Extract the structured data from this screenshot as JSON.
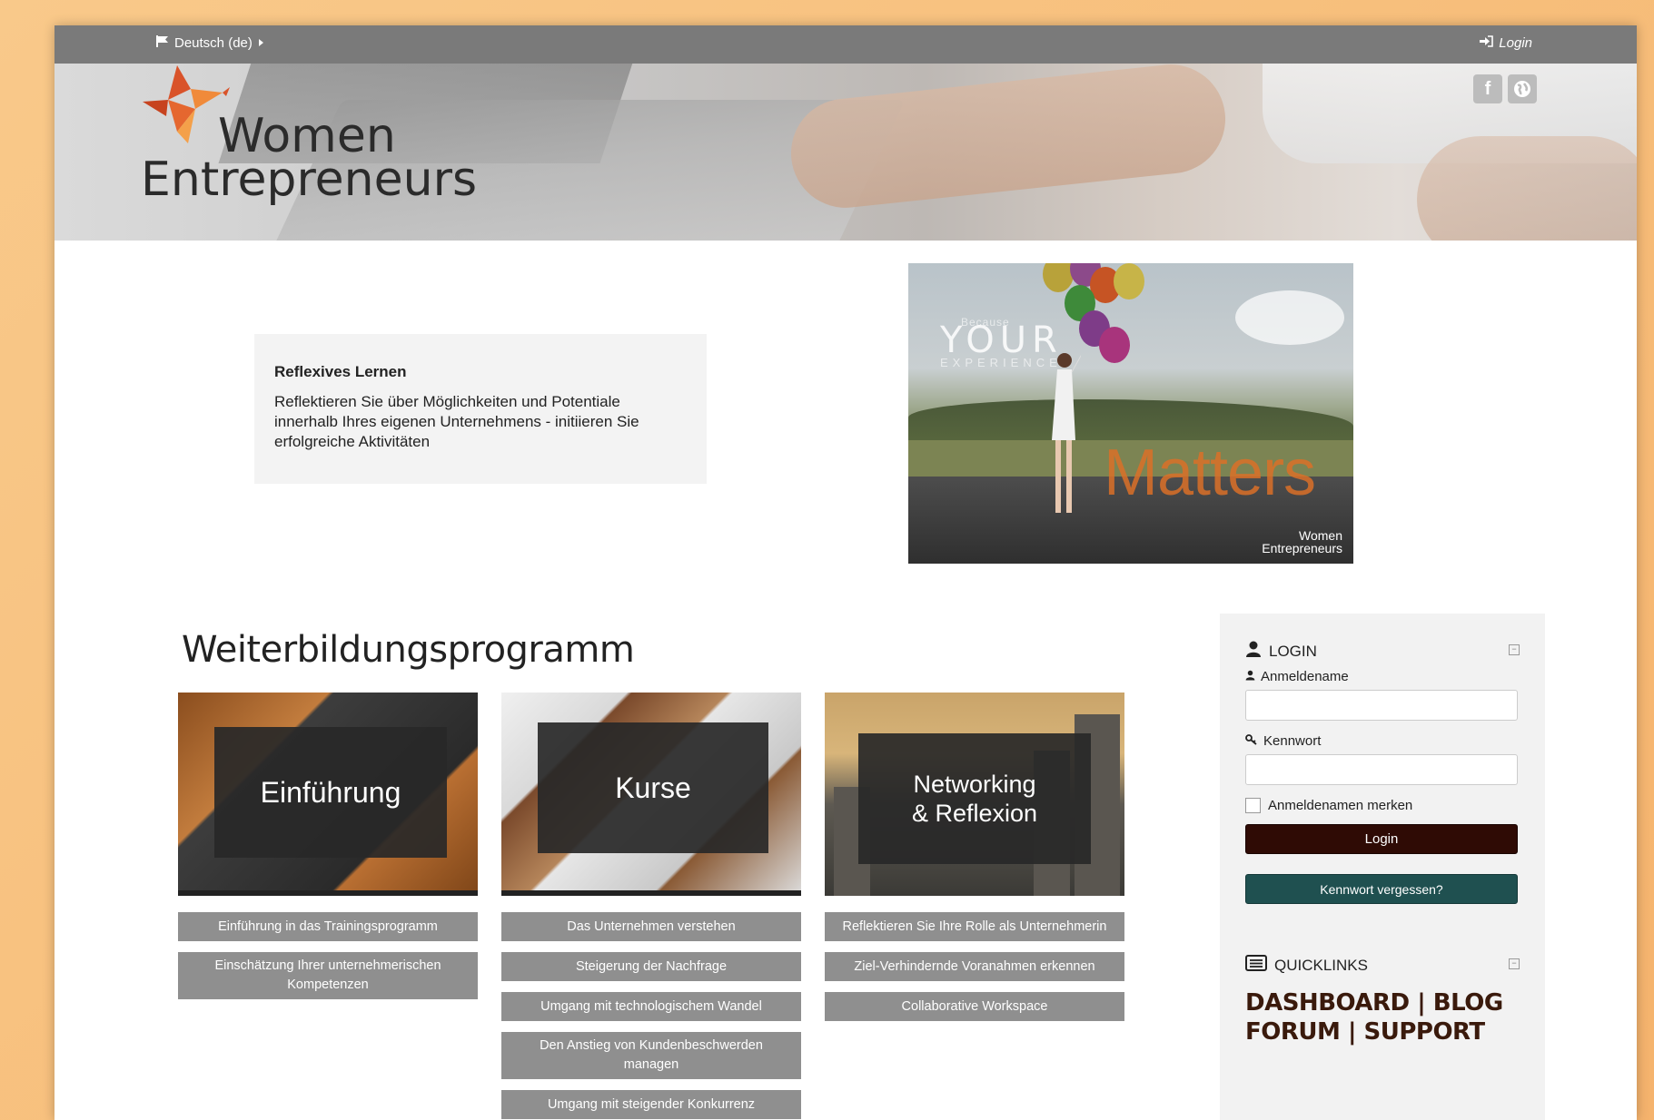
{
  "topnav": {
    "language": "Deutsch (de)",
    "login": "Login"
  },
  "header": {
    "logo_line1": "Women",
    "logo_line2": "Entrepreneurs",
    "social": [
      "facebook-icon",
      "globe-icon"
    ]
  },
  "intro": {
    "title": "Reflexives Lernen",
    "text": "Reflektieren Sie über Möglichkeiten und Potentiale innerhalb Ihres eigenen Unternehmens - initiieren Sie erfolgreiche Aktivitäten"
  },
  "poster": {
    "because": "Because",
    "your": "YOUR",
    "experience": "EXPERIENCE",
    "matters": "Matters",
    "logo1": "Women",
    "logo2": "Entrepreneurs"
  },
  "programme": {
    "title": "Weiterbildungsprogramm",
    "tiles": [
      {
        "label": "Einführung",
        "links": [
          "Einführung in das Trainingsprogramm",
          "Einschätzung Ihrer unternehmerischen Kompetenzen"
        ]
      },
      {
        "label": "Kurse",
        "links": [
          "Das Unternehmen verstehen",
          "Steigerung der Nachfrage",
          "Umgang mit technologischem Wandel",
          "Den Anstieg von Kundenbeschwerden managen",
          "Umgang mit steigender Konkurrenz"
        ]
      },
      {
        "label_line1": "Networking",
        "label_line2": "& Reflexion",
        "links": [
          "Reflektieren Sie Ihre Rolle als Unternehmerin",
          "Ziel-Verhindernde Voranahmen erkennen",
          "Collaborative Workspace"
        ]
      }
    ]
  },
  "sidebar": {
    "login_title": "LOGIN",
    "username_label": "Anmeldename",
    "password_label": "Kennwort",
    "remember_label": "Anmeldenamen merken",
    "login_button": "Login",
    "forgot_button": "Kennwort vergessen?",
    "quicklinks_title": "QUICKLINKS",
    "quicklinks": {
      "dashboard": "DASHBOARD",
      "blog": "BLOG",
      "forum": "FORUM",
      "support": "SUPPORT",
      "separator": "|"
    }
  }
}
